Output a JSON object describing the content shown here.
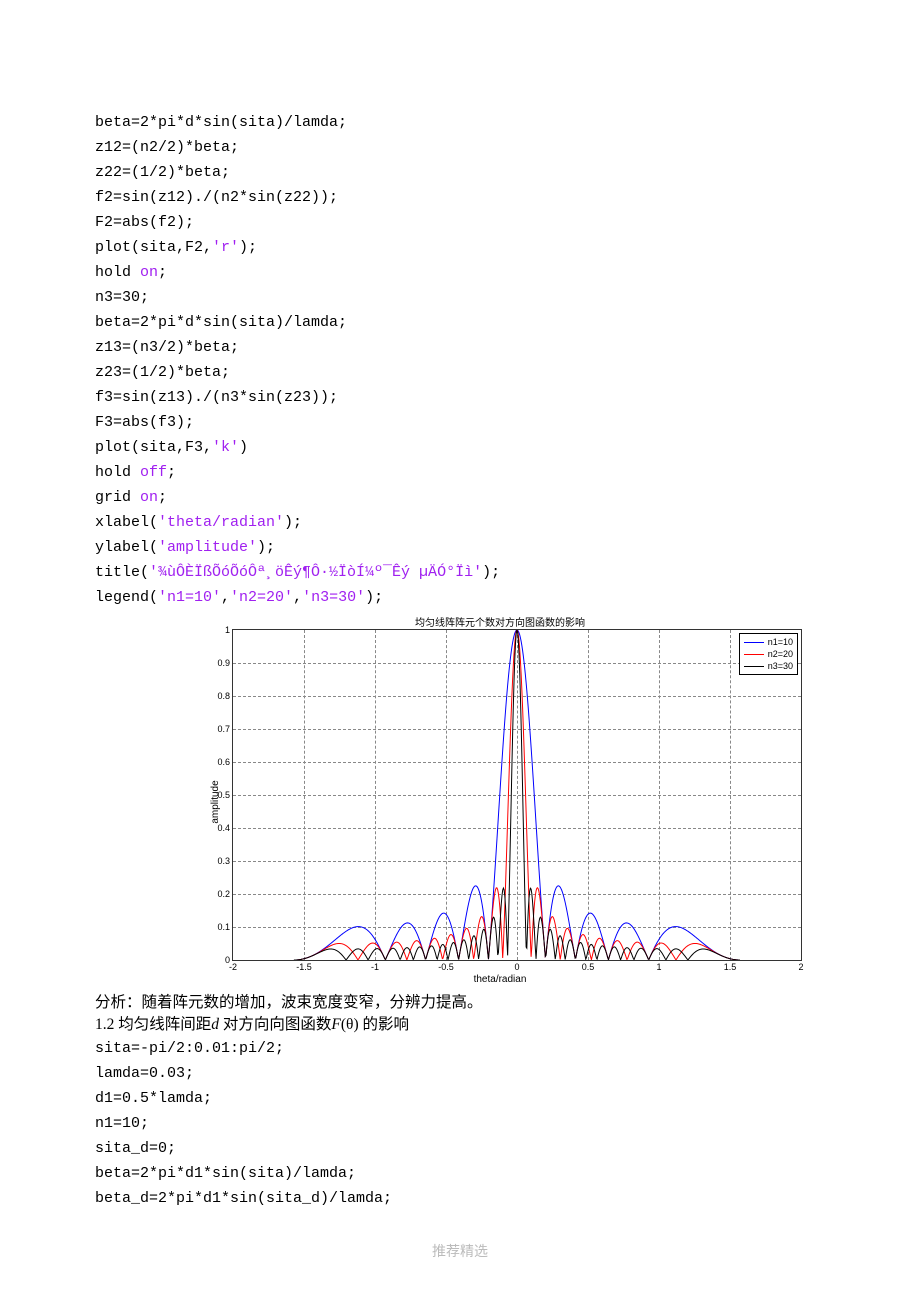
{
  "code_block_1": [
    {
      "segs": [
        {
          "t": "beta=2*pi*d*sin(sita)/lamda;"
        }
      ]
    },
    {
      "segs": [
        {
          "t": "z12=(n2/2)*beta;"
        }
      ]
    },
    {
      "segs": [
        {
          "t": "z22=(1/2)*beta;"
        }
      ]
    },
    {
      "segs": [
        {
          "t": "f2=sin(z12)./(n2*sin(z22));"
        }
      ]
    },
    {
      "segs": [
        {
          "t": "F2=abs(f2);"
        }
      ]
    },
    {
      "segs": [
        {
          "t": "plot(sita,F2,"
        },
        {
          "t": "'r'",
          "cls": "str"
        },
        {
          "t": ");"
        }
      ]
    },
    {
      "segs": [
        {
          "t": "hold "
        },
        {
          "t": "on",
          "cls": "str"
        },
        {
          "t": ";"
        }
      ]
    },
    {
      "segs": [
        {
          "t": "n3=30;"
        }
      ]
    },
    {
      "segs": [
        {
          "t": "beta=2*pi*d*sin(sita)/lamda;"
        }
      ]
    },
    {
      "segs": [
        {
          "t": "z13=(n3/2)*beta;"
        }
      ]
    },
    {
      "segs": [
        {
          "t": "z23=(1/2)*beta;"
        }
      ]
    },
    {
      "segs": [
        {
          "t": "f3=sin(z13)./(n3*sin(z23));"
        }
      ]
    },
    {
      "segs": [
        {
          "t": "F3=abs(f3);"
        }
      ]
    },
    {
      "segs": [
        {
          "t": "plot(sita,F3,"
        },
        {
          "t": "'k'",
          "cls": "str"
        },
        {
          "t": ")"
        }
      ]
    },
    {
      "segs": [
        {
          "t": "hold "
        },
        {
          "t": "off",
          "cls": "str"
        },
        {
          "t": ";"
        }
      ]
    },
    {
      "segs": [
        {
          "t": "grid "
        },
        {
          "t": "on",
          "cls": "str"
        },
        {
          "t": ";"
        }
      ]
    },
    {
      "segs": [
        {
          "t": "xlabel("
        },
        {
          "t": "'theta/radian'",
          "cls": "str"
        },
        {
          "t": ");"
        }
      ]
    },
    {
      "segs": [
        {
          "t": "ylabel("
        },
        {
          "t": "'amplitude'",
          "cls": "str"
        },
        {
          "t": ");"
        }
      ]
    },
    {
      "segs": [
        {
          "t": "title("
        },
        {
          "t": "'¾ùÔÈÏßÕóÕóÔª¸öÊý¶Ô·½ÏòÍ¼º¯Êý µÄÓ°Ïì'",
          "cls": "str"
        },
        {
          "t": ");"
        }
      ]
    },
    {
      "segs": [
        {
          "t": "legend("
        },
        {
          "t": "'n1=10'",
          "cls": "str"
        },
        {
          "t": ","
        },
        {
          "t": "'n2=20'",
          "cls": "str"
        },
        {
          "t": ","
        },
        {
          "t": "'n3=30'",
          "cls": "str"
        },
        {
          "t": ");"
        }
      ]
    }
  ],
  "analysis_text": "分析：随着阵元数的增加，波束宽度变窄，分辨力提高。",
  "section_heading_prefix": "1.2 均匀线阵间距",
  "section_heading_d": "d",
  "section_heading_mid": " 对方向向图函数",
  "section_heading_F": "F",
  "section_heading_theta": "(θ)",
  "section_heading_suffix": " 的影响",
  "code_block_2": [
    {
      "segs": [
        {
          "t": "sita=-pi/2:0.01:pi/2;"
        }
      ]
    },
    {
      "segs": [
        {
          "t": "lamda=0.03;"
        }
      ]
    },
    {
      "segs": [
        {
          "t": "d1=0.5*lamda;"
        }
      ]
    },
    {
      "segs": [
        {
          "t": "n1=10;"
        }
      ]
    },
    {
      "segs": [
        {
          "t": "sita_d=0;"
        }
      ]
    },
    {
      "segs": [
        {
          "t": "beta=2*pi*d1*sin(sita)/lamda;"
        }
      ]
    },
    {
      "segs": [
        {
          "t": "beta_d=2*pi*d1*sin(sita_d)/lamda;"
        }
      ]
    }
  ],
  "footer_text": "推荐精选",
  "chart_data": {
    "type": "line",
    "title": "均匀线阵阵元个数对方向图函数的影响",
    "xlabel": "theta/radian",
    "ylabel": "amplitude",
    "xlim": [
      -2,
      2
    ],
    "ylim": [
      0,
      1
    ],
    "xticks": [
      -2,
      -1.5,
      -1,
      -0.5,
      0,
      0.5,
      1,
      1.5,
      2
    ],
    "yticks": [
      0,
      0.1,
      0.2,
      0.3,
      0.4,
      0.5,
      0.6,
      0.7,
      0.8,
      0.9,
      1
    ],
    "legend": [
      "n1=10",
      "n2=20",
      "n3=30"
    ],
    "colors": [
      "#0000ff",
      "#ff0000",
      "#000000"
    ],
    "series": [
      {
        "name": "n1=10",
        "n": 10,
        "color": "#0000ff"
      },
      {
        "name": "n2=20",
        "n": 20,
        "color": "#ff0000"
      },
      {
        "name": "n3=30",
        "n": 30,
        "color": "#000000"
      }
    ],
    "formula": "abs(sin(n/2 * pi * sin(theta)) / (n * sin(0.5 * pi * sin(theta))))",
    "grid": true
  }
}
